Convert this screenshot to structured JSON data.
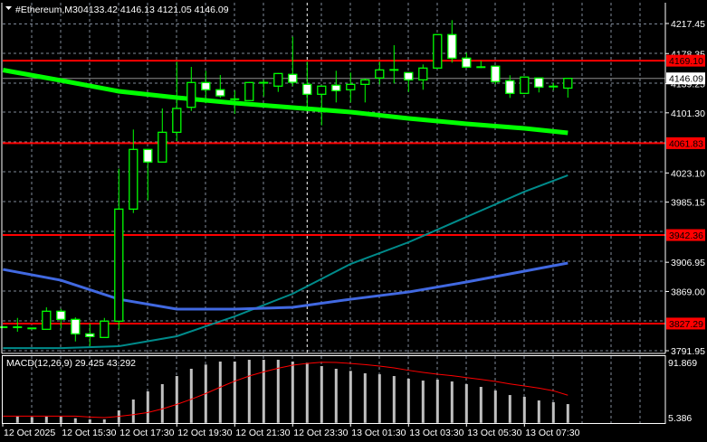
{
  "header": {
    "symbol_timeframe": "#Ethereum,M30",
    "ohlc_text": "4133.42 4146.13 4121.05 4146.09",
    "menu_icon": "triangle-down-icon"
  },
  "colors": {
    "background": "#000000",
    "bull_candle": "#00ff00",
    "bear_body": "#ffffff",
    "grid": "#7f8a99",
    "level_line": "#ff0000",
    "ma_slow": "#00ff00",
    "ma_teal": "#008b8b",
    "ma_blue": "#4169e1",
    "macd_hist": "#c0c0c0",
    "macd_signal": "#ff0000"
  },
  "chart_data": [
    {
      "type": "candlestick",
      "price_axis_ticks": [
        "4217.45",
        "4178.35",
        "4139.25",
        "4101.30",
        "4023.10",
        "3985.15",
        "3906.95",
        "3869.00",
        "3791.95"
      ],
      "ylim": [
        3791.95,
        4217.45
      ],
      "grid": true,
      "time_axis_labels": [
        {
          "label": "12 Oct 2025",
          "t": "12 Oct 13:30"
        },
        {
          "label": "12 Oct 15:30",
          "t": "12 Oct 15:30"
        },
        {
          "label": "12 Oct 17:30",
          "t": "12 Oct 17:30"
        },
        {
          "label": "12 Oct 19:30",
          "t": "12 Oct 19:30"
        },
        {
          "label": "12 Oct 21:30",
          "t": "12 Oct 21:30"
        },
        {
          "label": "12 Oct 23:30",
          "t": "12 Oct 23:30"
        },
        {
          "label": "13 Oct 01:30",
          "t": "13 Oct 01:30"
        },
        {
          "label": "13 Oct 03:30",
          "t": "13 Oct 03:30"
        },
        {
          "label": "13 Oct 05:30",
          "t": "13 Oct 05:30"
        },
        {
          "label": "13 Oct 07:30",
          "t": "13 Oct 07:30"
        }
      ],
      "day_separator": "13 Oct 00:00",
      "levels": [
        {
          "price": "4169.10"
        },
        {
          "price": "4061.83"
        },
        {
          "price": "3942.36"
        },
        {
          "price": "3827.29"
        }
      ],
      "current_price": "4146.09",
      "candles": [
        {
          "t": "12 Oct 13:30",
          "o": 3822.5,
          "h": 3823.5,
          "l": 3821.5,
          "c": 3822.5
        },
        {
          "t": "12 Oct 14:00",
          "o": 3822.0,
          "h": 3834.6,
          "l": 3816.6,
          "c": 3822.5
        },
        {
          "t": "12 Oct 14:30",
          "o": 3821.0,
          "h": 3822.0,
          "l": 3820.0,
          "c": 3821.0
        },
        {
          "t": "12 Oct 15:00",
          "o": 3819.8,
          "h": 3848.4,
          "l": 3819.8,
          "c": 3843.3
        },
        {
          "t": "12 Oct 15:30",
          "o": 3843.3,
          "h": 3846.4,
          "l": 3821.0,
          "c": 3832.7
        },
        {
          "t": "12 Oct 16:00",
          "o": 3832.7,
          "h": 3835.4,
          "l": 3804.0,
          "c": 3813.9
        },
        {
          "t": "12 Oct 16:30",
          "o": 3813.9,
          "h": 3827.2,
          "l": 3798.2,
          "c": 3810.4
        },
        {
          "t": "12 Oct 17:00",
          "o": 3809.2,
          "h": 3834.6,
          "l": 3809.0,
          "c": 3830.4
        },
        {
          "t": "12 Oct 17:30",
          "o": 3830.4,
          "h": 4028.6,
          "l": 3819.8,
          "c": 3976.1
        },
        {
          "t": "12 Oct 18:00",
          "o": 3976.1,
          "h": 4079.6,
          "l": 3971.0,
          "c": 4053.7
        },
        {
          "t": "12 Oct 18:30",
          "o": 4053.7,
          "h": 4054.5,
          "l": 3987.4,
          "c": 4037.3
        },
        {
          "t": "12 Oct 19:00",
          "o": 4037.3,
          "h": 4107.0,
          "l": 4037.0,
          "c": 4076.0
        },
        {
          "t": "12 Oct 19:30",
          "o": 4076.0,
          "h": 4167.7,
          "l": 4064.6,
          "c": 4107.0
        },
        {
          "t": "12 Oct 20:00",
          "o": 4108.5,
          "h": 4161.0,
          "l": 4103.8,
          "c": 4140.7
        },
        {
          "t": "12 Oct 20:30",
          "o": 4140.7,
          "h": 4156.0,
          "l": 4113.7,
          "c": 4131.3
        },
        {
          "t": "12 Oct 21:00",
          "o": 4131.3,
          "h": 4150.5,
          "l": 4120.7,
          "c": 4123.4
        },
        {
          "t": "12 Oct 21:30",
          "o": 4118.5,
          "h": 4130.5,
          "l": 4100.0,
          "c": 4119.0
        },
        {
          "t": "12 Oct 22:00",
          "o": 4117.2,
          "h": 4141.5,
          "l": 4116.5,
          "c": 4140.7
        },
        {
          "t": "12 Oct 22:30",
          "o": 4140.2,
          "h": 4144.2,
          "l": 4122.6,
          "c": 4140.4
        },
        {
          "t": "12 Oct 23:00",
          "o": 4136.0,
          "h": 4153.0,
          "l": 4128.5,
          "c": 4152.4
        },
        {
          "t": "12 Oct 23:30",
          "o": 4151.3,
          "h": 4200.2,
          "l": 4136.3,
          "c": 4141.0
        },
        {
          "t": "13 Oct 00:00",
          "o": 4138.3,
          "h": 4167.7,
          "l": 4103.1,
          "c": 4125.4
        },
        {
          "t": "13 Oct 00:30",
          "o": 4125.4,
          "h": 4136.5,
          "l": 4085.0,
          "c": 4136.0
        },
        {
          "t": "13 Oct 01:00",
          "o": 4137.2,
          "h": 4156.0,
          "l": 4114.8,
          "c": 4130.1
        },
        {
          "t": "13 Oct 01:30",
          "o": 4131.3,
          "h": 4153.6,
          "l": 4114.8,
          "c": 4138.3
        },
        {
          "t": "13 Oct 02:00",
          "o": 4138.3,
          "h": 4146.1,
          "l": 4114.8,
          "c": 4144.2
        },
        {
          "t": "13 Oct 02:30",
          "o": 4146.6,
          "h": 4167.7,
          "l": 4138.3,
          "c": 4157.1
        },
        {
          "t": "13 Oct 03:00",
          "o": 4157.1,
          "h": 4189.2,
          "l": 4139.5,
          "c": 4154.8
        },
        {
          "t": "13 Oct 03:30",
          "o": 4153.6,
          "h": 4154.0,
          "l": 4128.5,
          "c": 4144.2
        },
        {
          "t": "13 Oct 04:00",
          "o": 4144.2,
          "h": 4164.2,
          "l": 4131.3,
          "c": 4159.5
        },
        {
          "t": "13 Oct 04:30",
          "o": 4159.5,
          "h": 4203.5,
          "l": 4159.0,
          "c": 4203.0
        },
        {
          "t": "13 Oct 05:00",
          "o": 4203.0,
          "h": 4221.8,
          "l": 4166.5,
          "c": 4172.4
        },
        {
          "t": "13 Oct 05:30",
          "o": 4172.4,
          "h": 4179.5,
          "l": 4160.0,
          "c": 4160.7
        },
        {
          "t": "13 Oct 06:00",
          "o": 4160.7,
          "h": 4168.9,
          "l": 4159.5,
          "c": 4160.2
        },
        {
          "t": "13 Oct 06:30",
          "o": 4161.9,
          "h": 4162.5,
          "l": 4138.3,
          "c": 4141.9
        },
        {
          "t": "13 Oct 07:00",
          "o": 4143.0,
          "h": 4150.1,
          "l": 4120.7,
          "c": 4126.6
        },
        {
          "t": "13 Oct 07:30",
          "o": 4126.6,
          "h": 4148.5,
          "l": 4126.0,
          "c": 4147.8
        },
        {
          "t": "13 Oct 08:00",
          "o": 4146.6,
          "h": 4147.0,
          "l": 4127.8,
          "c": 4134.8
        },
        {
          "t": "13 Oct 08:30",
          "o": 4135.5,
          "h": 4140.2,
          "l": 4130.5,
          "c": 4135.3
        },
        {
          "t": "13 Oct 09:00",
          "o": 4133.42,
          "h": 4146.13,
          "l": 4121.05,
          "c": 4146.09
        }
      ],
      "moving_averages": [
        {
          "color": "#00ff00",
          "points": [
            [
              "12 Oct 13:30",
              4156.9
            ],
            [
              "12 Oct 15:30",
              4143.4
            ],
            [
              "12 Oct 17:30",
              4129.3
            ],
            [
              "12 Oct 19:30",
              4121.1
            ],
            [
              "12 Oct 21:30",
              4114.0
            ],
            [
              "12 Oct 23:30",
              4108.1
            ],
            [
              "13 Oct 01:30",
              4102.3
            ],
            [
              "13 Oct 03:30",
              4094.0
            ],
            [
              "13 Oct 05:30",
              4087.0
            ],
            [
              "13 Oct 07:30",
              4081.1
            ],
            [
              "13 Oct 09:00",
              4075.2
            ]
          ]
        },
        {
          "color": "#008b8b",
          "points": [
            [
              "12 Oct 13:30",
              3795.4
            ],
            [
              "12 Oct 15:30",
              3795.4
            ],
            [
              "12 Oct 17:30",
              3797.8
            ],
            [
              "12 Oct 19:30",
              3810.8
            ],
            [
              "12 Oct 21:30",
              3836.6
            ],
            [
              "12 Oct 23:30",
              3866.0
            ],
            [
              "13 Oct 01:30",
              3904.8
            ],
            [
              "13 Oct 03:30",
              3933.0
            ],
            [
              "13 Oct 05:30",
              3965.9
            ],
            [
              "13 Oct 07:30",
              3998.8
            ],
            [
              "13 Oct 09:00",
              4020.0
            ]
          ]
        },
        {
          "color": "#4169e1",
          "points": [
            [
              "12 Oct 13:30",
              3897.7
            ],
            [
              "12 Oct 15:30",
              3883.6
            ],
            [
              "12 Oct 17:30",
              3858.9
            ],
            [
              "12 Oct 19:30",
              3846.0
            ],
            [
              "12 Oct 21:30",
              3846.0
            ],
            [
              "12 Oct 23:30",
              3848.4
            ],
            [
              "13 Oct 01:30",
              3858.9
            ],
            [
              "13 Oct 03:30",
              3868.3
            ],
            [
              "13 Oct 05:30",
              3881.3
            ],
            [
              "13 Oct 07:30",
              3895.4
            ],
            [
              "13 Oct 09:00",
              3906.0
            ]
          ]
        }
      ]
    },
    {
      "type": "bar+line",
      "label": "MACD(12,26,9) 29.425 43.292",
      "axis_ticks": [
        "91.869",
        "5.386"
      ],
      "ylim": [
        0,
        98.9
      ],
      "macd": [
        10.0,
        10.0,
        9.0,
        9.6,
        9.6,
        7.2,
        5.4,
        5.4,
        19.5,
        36.6,
        49.3,
        60.7,
        73.4,
        84.8,
        91.4,
        96.1,
        96.1,
        98.9,
        98.9,
        98.9,
        96.1,
        94.2,
        89.0,
        84.8,
        81.5,
        77.7,
        76.2,
        73.4,
        69.2,
        66.3,
        67.8,
        64.9,
        60.7,
        56.4,
        50.7,
        43.6,
        40.8,
        35.1,
        32.3,
        29.425
      ],
      "signal": [
        10.5,
        10.5,
        10.5,
        10.5,
        10.5,
        10.5,
        9.1,
        8.2,
        10.1,
        12.9,
        16.2,
        21.9,
        29.0,
        37.0,
        46.0,
        55.9,
        65.4,
        73.4,
        80.0,
        85.7,
        90.4,
        93.2,
        95.1,
        94.7,
        93.2,
        91.4,
        89.0,
        86.2,
        82.4,
        79.1,
        76.2,
        73.9,
        71.0,
        68.2,
        64.9,
        61.1,
        57.8,
        54.5,
        50.3,
        43.292
      ]
    }
  ]
}
